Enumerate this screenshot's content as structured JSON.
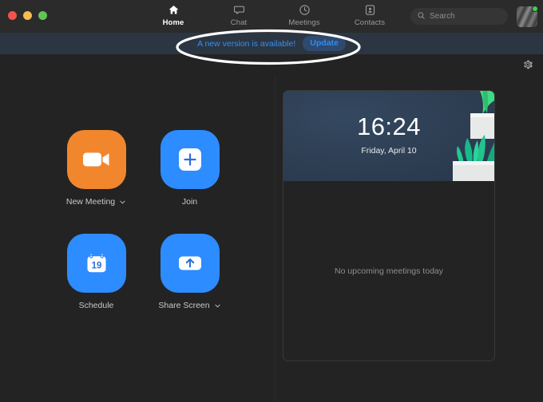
{
  "window": {
    "traffic_lights": [
      {
        "name": "close",
        "color": "#f2544b"
      },
      {
        "name": "minimize",
        "color": "#f4bd4f"
      },
      {
        "name": "zoom",
        "color": "#61c454"
      }
    ]
  },
  "nav": {
    "items": [
      {
        "label": "Home",
        "icon": "home-icon",
        "active": true
      },
      {
        "label": "Chat",
        "icon": "chat-icon",
        "active": false
      },
      {
        "label": "Meetings",
        "icon": "clock-icon",
        "active": false
      },
      {
        "label": "Contacts",
        "icon": "contacts-icon",
        "active": false
      }
    ]
  },
  "search": {
    "placeholder": "Search",
    "value": "",
    "icon": "search-icon"
  },
  "profile": {
    "avatar_alt": "User avatar",
    "status": "available",
    "status_color": "#3ed44b"
  },
  "banner": {
    "message": "A new version is available!",
    "button_label": "Update",
    "text_color": "#3a8ef0",
    "background": "#2b3642"
  },
  "annotation": {
    "shape": "ellipse",
    "color": "#ffffff",
    "target": "update-banner"
  },
  "settings": {
    "icon": "gear-icon",
    "tooltip": "Settings"
  },
  "actions": [
    {
      "label": "New Meeting",
      "icon": "video-camera-icon",
      "color": "#f2862c",
      "has_dropdown": true
    },
    {
      "label": "Join",
      "icon": "plus-square-icon",
      "color": "#2d8cff",
      "has_dropdown": false
    },
    {
      "label": "Schedule",
      "icon": "calendar-icon",
      "icon_day": "19",
      "color": "#2d8cff",
      "has_dropdown": false
    },
    {
      "label": "Share Screen",
      "icon": "share-screen-icon",
      "color": "#2d8cff",
      "has_dropdown": true
    }
  ],
  "meeting_card": {
    "time": "16:24",
    "date": "Friday, April 10",
    "empty_state": "No upcoming meetings today",
    "illustration": "potted-plant-illustration"
  }
}
